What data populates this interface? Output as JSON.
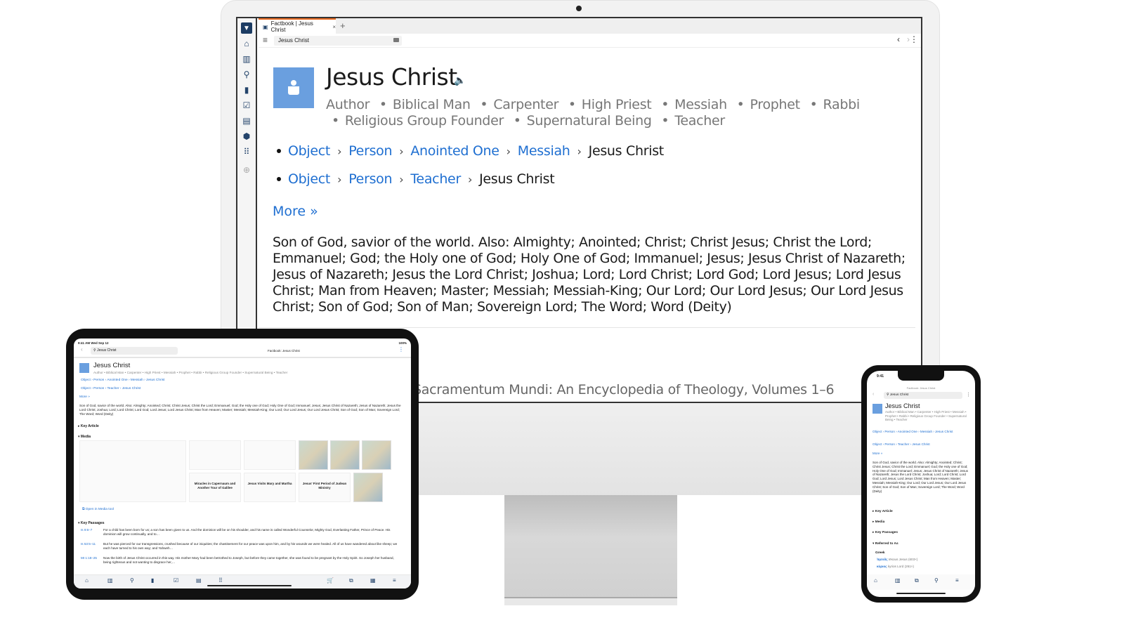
{
  "desktop": {
    "tab": {
      "label": "Factbook | Jesus Christ",
      "close": "×",
      "add": "+"
    },
    "address": "Jesus Christ",
    "sidebar_icons": [
      "logo-icon",
      "home-icon",
      "library-icon",
      "search-icon",
      "bible-icon",
      "checklist-icon",
      "document-icon",
      "badge-icon",
      "apps-icon",
      "add-icon"
    ],
    "nav": {
      "back": "‹",
      "forward": "›",
      "more": "⋮"
    },
    "entity": {
      "title": "Jesus Christ",
      "types": [
        "Author",
        "Biblical Man",
        "Carpenter",
        "High Priest",
        "Messiah",
        "Prophet",
        "Rabbi",
        "Religious Group Founder",
        "Supernatural Being",
        "Teacher"
      ],
      "breadcrumbs": [
        {
          "links": [
            "Object",
            "Person",
            "Anointed One",
            "Messiah"
          ],
          "current": "Jesus Christ"
        },
        {
          "links": [
            "Object",
            "Person",
            "Teacher"
          ],
          "current": "Jesus Christ"
        }
      ],
      "more_label": "More »",
      "description": "Son of God, savior of the world. Also: Almighty; Anointed; Christ; Christ Jesus; Christ the Lord; Emmanuel; God; the Holy one of God; Holy One of God; Immanuel; Jesus; Jesus Christ of Nazareth; Jesus of Nazareth; Jesus the Lord Christ; Joshua; Lord; Lord Christ; Lord God; Lord Jesus; Lord Jesus Christ; Man from Heaven; Master; Messiah; Messiah-King; Our Lord; Our Lord Jesus; Our Lord Jesus Christ; Son of God; Son of Man; Sovereign Lord; The Word; Word (Deity)",
      "key_article_title": "Sacramentum Mundi: An Encyclopedia of Theology, Volumes 1–6"
    }
  },
  "tablet": {
    "status_left": "9:41 AM  Wed Sep 12",
    "status_right": "100%",
    "search": "Jesus Christ",
    "doc_title": "Factbook: Jesus Christ",
    "title": "Jesus Christ",
    "types_line": "Author • Biblical Man • Carpenter • High Priest • Messiah • Prophet • Rabbi • Religious Group Founder • Supernatural Being • Teacher",
    "crumbs_1": "Object › Person › Anointed One › Messiah › Jesus Christ",
    "crumbs_2": "Object › Person › Teacher › Jesus Christ",
    "more_label": "More »",
    "description": "Son of God, savior of the world. Also: Almighty; Anointed; Christ; Christ Jesus; Christ the Lord; Emmanuel; God; the Holy one of God; Holy One of God; Immanuel; Jesus; Jesus Christ of Nazareth; Jesus of Nazareth; Jesus the Lord Christ; Joshua; Lord; Lord Christ; Lord God; Lord Jesus; Lord Jesus Christ; Man from Heaven; Master; Messiah; Messiah-King; Our Lord; Our Lord Jesus; Our Lord Jesus Christ; Son of God; Son of Man; Sovereign Lord; The Word; Word (Deity)",
    "sections": {
      "key_article": "▸ Key Article",
      "media": "▾ Media",
      "key_passages": "▾ Key Passages"
    },
    "media_captions": [
      "Miracles in Capernaum and Another Tour of Galilee",
      "Jesus Visits Mary and Martha",
      "Jesus' First Period of Judean Ministry"
    ],
    "open_media": "Open in Media tool",
    "passages": [
      {
        "ref": "Is 9:6–7",
        "text": "For a child has been born for us; a son has been given to us. And the dominion will be on his shoulder, and his name is called Wonderful Counselor, Mighty God, Everlasting Father, Prince of Peace. His dominion will grow continually, and to…"
      },
      {
        "ref": "Is 53:5–11",
        "text": "But he was pierced for our transgressions, crushed because of our iniquities; the chastisement for our peace was upon him, and by his wounds we were healed. All of us have wandered about like sheep; we each have turned to his own way; and Yahweh…"
      },
      {
        "ref": "Mt 1:18–25",
        "text": "Now the birth of Jesus Christ occurred in this way. His mother Mary had been betrothed to Joseph, but before they came together, she was found to be pregnant by the Holy Spirit. So Joseph her husband, being righteous and not wanting to disgrace her,…"
      }
    ]
  },
  "phone": {
    "time": "9:41",
    "doc_title": "Factbook: Jesus Christ",
    "search": "Jesus Christ",
    "title": "Jesus Christ",
    "types_line": "Author • Biblical Man • Carpenter • High Priest • Messiah • Prophet • Rabbi • Religious Group Founder • Supernatural Being • Teacher",
    "crumbs_1": "Object › Person › Anointed One › Messiah › Jesus Christ",
    "crumbs_2": "Object › Person › Teacher › Jesus Christ",
    "more_label": "More »",
    "description": "Son of God, savior of the world. Also: Almighty; Anointed; Christ; Christ Jesus; Christ the Lord; Emmanuel; God; the Holy one of God; Holy One of God; Immanuel; Jesus; Jesus Christ of Nazareth; Jesus of Nazareth; Jesus the Lord Christ; Joshua; Lord; Lord Christ; Lord God; Lord Jesus; Lord Jesus Christ; Man from Heaven; Master; Messiah; Messiah-King; Our Lord; Our Lord Jesus; Our Lord Jesus Christ; Son of God; Son of Man; Sovereign Lord; The Word; Word (Deity)",
    "sections": {
      "key_article": "▸ Key Article",
      "media": "▸ Media",
      "key_passages": "▸ Key Passages",
      "referred_to_as": "▾ Referred to As"
    },
    "greek_label": "Greek",
    "words": [
      {
        "greek": "Ἰησοῦς",
        "translit": "Iēsous",
        "gloss": "Jesus",
        "count": "(603×)"
      },
      {
        "greek": "κύριος",
        "translit": "kyrios",
        "gloss": "Lord",
        "count": "(261×)"
      }
    ]
  },
  "colors": {
    "accent": "#1f6fd1",
    "entity_icon": "#6a9fdf",
    "tab_accent": "#ea6a1f",
    "logo": "#1c3c63"
  }
}
